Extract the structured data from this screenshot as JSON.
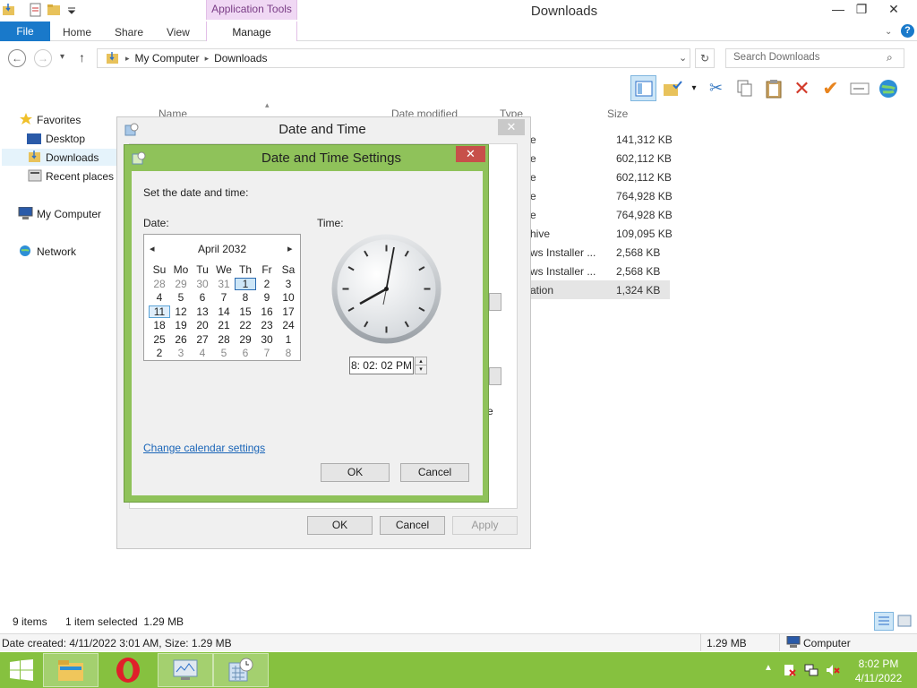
{
  "window": {
    "title": "Downloads",
    "app_tools": "Application Tools",
    "minimize": "—",
    "maximize": "❐",
    "close": "✕"
  },
  "ribbon": {
    "file": "File",
    "home": "Home",
    "share": "Share",
    "view": "View",
    "manage": "Manage",
    "help": "?"
  },
  "nav": {
    "breadcrumb": [
      "My Computer",
      "Downloads"
    ],
    "search_placeholder": "Search Downloads"
  },
  "sidebar": {
    "favorites": "Favorites",
    "desktop": "Desktop",
    "downloads": "Downloads",
    "recent": "Recent places",
    "computer": "My Computer",
    "network": "Network"
  },
  "columns": {
    "name": "Name",
    "date": "Date modified",
    "type": "Type",
    "size": "Size"
  },
  "files": [
    {
      "type": "e",
      "size": "141,312 KB"
    },
    {
      "type": "e",
      "size": "602,112 KB"
    },
    {
      "type": "e",
      "size": "602,112 KB"
    },
    {
      "type": "e",
      "size": "764,928 KB"
    },
    {
      "type": "e",
      "size": "764,928 KB"
    },
    {
      "type": "hive",
      "size": "109,095 KB"
    },
    {
      "type": "ws Installer ...",
      "size": "2,568 KB"
    },
    {
      "type": "ws Installer ...",
      "size": "2,568 KB"
    },
    {
      "type": "ation",
      "size": "1,324 KB"
    }
  ],
  "dlg_outer": {
    "title": "Date and Time",
    "close": "✕",
    "ok": "OK",
    "cancel": "Cancel",
    "apply": "Apply",
    "partial_e": "e"
  },
  "dlg_inner": {
    "title": "Date and Time Settings",
    "close": "✕",
    "instruction": "Set the date and time:",
    "date_label": "Date:",
    "time_label": "Time:",
    "month": "April 2032",
    "prev": "◂",
    "next": "▸",
    "weekdays": [
      "Su",
      "Mo",
      "Tu",
      "We",
      "Th",
      "Fr",
      "Sa"
    ],
    "days": [
      "28",
      "29",
      "30",
      "31",
      "1",
      "2",
      "3",
      "4",
      "5",
      "6",
      "7",
      "8",
      "9",
      "10",
      "11",
      "12",
      "13",
      "14",
      "15",
      "16",
      "17",
      "18",
      "19",
      "20",
      "21",
      "22",
      "23",
      "24",
      "25",
      "26",
      "27",
      "28",
      "29",
      "30",
      "1",
      "2",
      "3",
      "4",
      "5",
      "6",
      "7",
      "8"
    ],
    "time_value": "8: 02: 02 PM",
    "link": "Change calendar settings",
    "ok": "OK",
    "cancel": "Cancel"
  },
  "status": {
    "items": "9 items",
    "selected": "1 item selected  1.29 MB",
    "details": "Date created: 4/11/2022 3:01 AM, Size: 1.29 MB",
    "size": "1.29 MB",
    "location": "Computer"
  },
  "taskbar": {
    "time": "8:02 PM",
    "date": "4/11/2022"
  },
  "colors": {
    "accent": "#1979ca",
    "taskbar": "#86c13f",
    "dialog_frame": "#8fc25a",
    "close_red": "#c7504a",
    "app_tools": "#f0d8f4"
  }
}
